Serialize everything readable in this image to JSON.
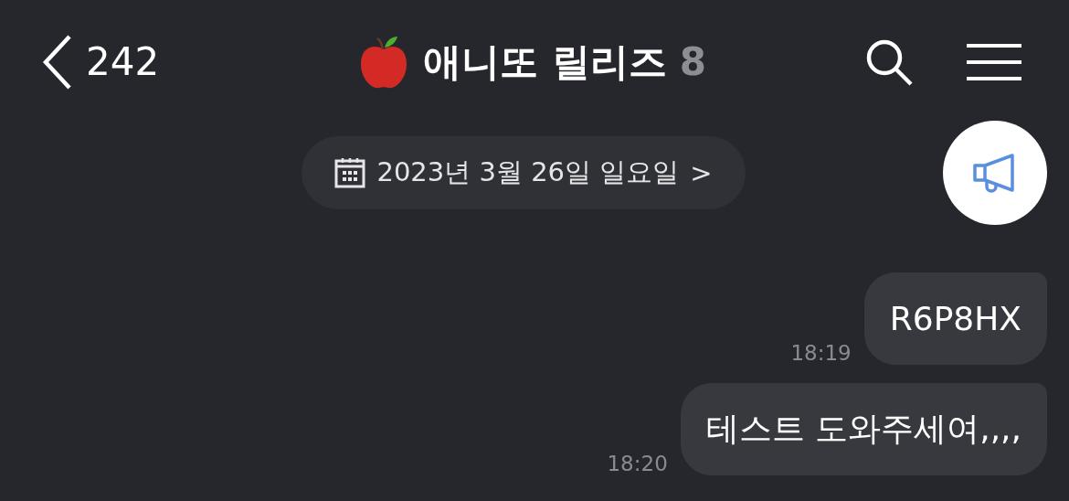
{
  "header": {
    "back_count": "242",
    "title": "애니또 릴리즈",
    "member_count": "8"
  },
  "date_divider": {
    "label": "2023년 3월 26일 일요일",
    "arrow": ">"
  },
  "messages": [
    {
      "text": "R6P8HX",
      "time": "18:19"
    },
    {
      "text": "테스트 도와주세여,,,,",
      "time": "18:20"
    }
  ]
}
